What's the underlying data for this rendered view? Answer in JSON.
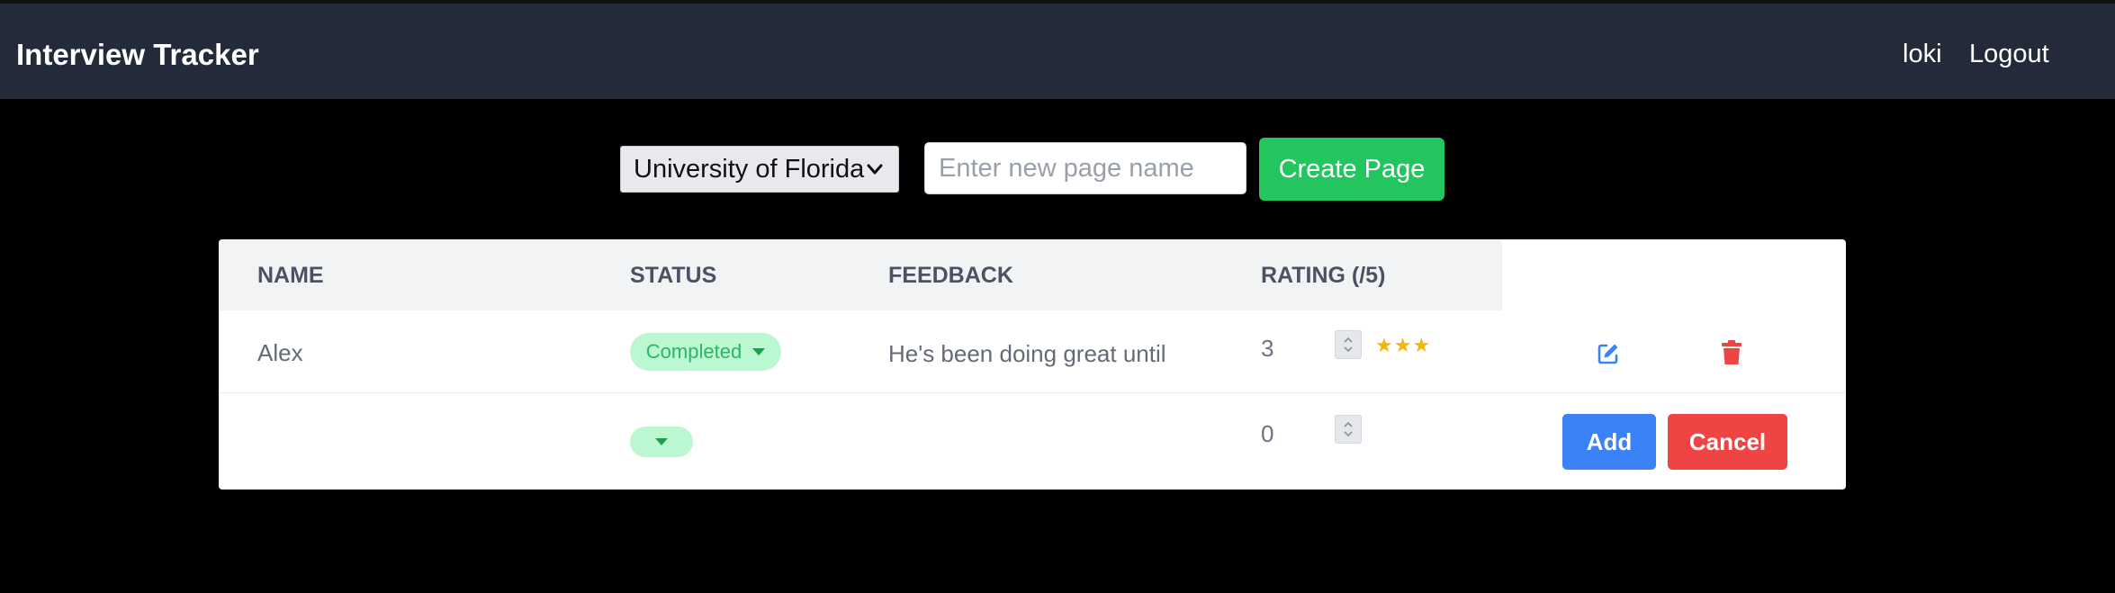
{
  "header": {
    "brand": "Interview Tracker",
    "user": "loki",
    "logout_label": "Logout"
  },
  "toolbar": {
    "selected_org": "University of Florida",
    "new_page_placeholder": "Enter new page name",
    "new_page_value": "",
    "create_label": "Create Page"
  },
  "table": {
    "columns": [
      "NAME",
      "STATUS",
      "FEEDBACK",
      "RATING (/5)"
    ],
    "rows": [
      {
        "name": "Alex",
        "status": "Completed",
        "feedback": "He's been doing great until",
        "rating": "3",
        "stars": "★★★"
      }
    ],
    "new_row": {
      "name": "",
      "status": "",
      "feedback": "",
      "rating": "0"
    },
    "add_label": "Add",
    "cancel_label": "Cancel"
  },
  "icons": {
    "edit": "edit-icon",
    "delete": "trash-icon",
    "dropdown": "chevron-down-icon",
    "spinner": "number-spinner-icon"
  },
  "colors": {
    "topbar": "#232b3b",
    "create_button": "#22c55e",
    "add_button": "#3b82f6",
    "cancel_button": "#ef4444",
    "status_pill": "#bbf7d0",
    "star": "#f5b50a"
  }
}
